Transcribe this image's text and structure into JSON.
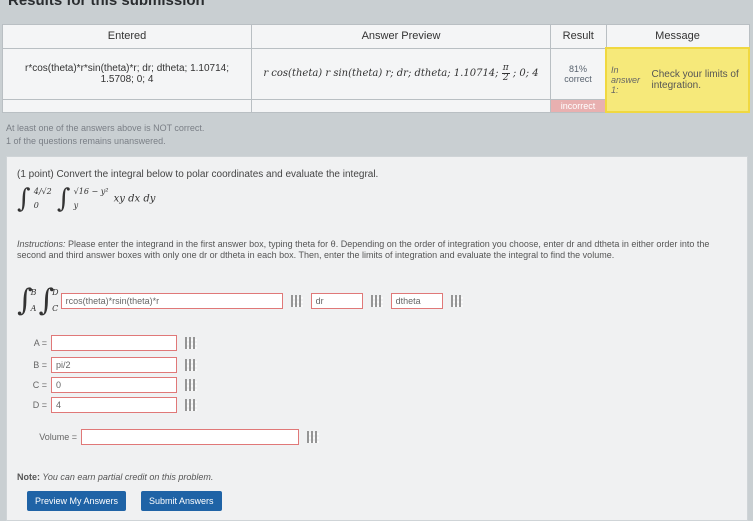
{
  "heading": "Results for this submission",
  "table": {
    "headers": [
      "Entered",
      "Answer Preview",
      "Result",
      "Message"
    ],
    "entered": "r*cos(theta)*r*sin(theta)*r; dr; dtheta; 1.10714; 1.5708; 0; 4",
    "preview_left": "r cos(theta) r sin(theta) r; dr; dtheta; 1.10714;",
    "preview_frac_num": "π",
    "preview_frac_den": "2",
    "preview_right": "; 0; 4",
    "result": "81% correct",
    "message_prefix": "In answer 1:",
    "message_text": "Check your limits of integration.",
    "incorrect": "incorrect"
  },
  "warnings": {
    "line1": "At least one of the answers above is NOT correct.",
    "line2": "1 of the questions remains unanswered."
  },
  "problem": {
    "intro": "(1 point) Convert the integral below to polar coordinates and evaluate the integral.",
    "outer_upper": "4/√2",
    "outer_lower": "0",
    "inner_upper": "√16 − y²",
    "inner_lower": "y",
    "integrand": "xy dx dy",
    "instructions_lead": "Instructions:",
    "instructions": " Please enter the integrand in the first answer box, typing theta for θ. Depending on the order of integration you choose, enter dr and dtheta in either order into the second and third answer boxes with only one dr or dtheta in each box. Then, enter the limits of integration and evaluate the integral to find the volume.",
    "lim_B": "B",
    "lim_A": "A",
    "lim_D": "D",
    "lim_C": "C",
    "integrand_value": "rcos(theta)*rsin(theta)*r",
    "d1_value": "dr",
    "d2_value": "dtheta",
    "A_label": "A =",
    "A_value": "",
    "B_label": "B =",
    "B_value": "pi/2",
    "C_label": "C =",
    "C_value": "0",
    "D_label": "D =",
    "D_value": "4",
    "volume_label": "Volume =",
    "volume_value": "",
    "note_bold": "Note:",
    "note": " You can earn partial credit on this problem.",
    "preview_button": "Preview My Answers",
    "submit_button": "Submit Answers"
  },
  "colors": {
    "accent": "#1f63a6",
    "message_bg": "#f6e97a",
    "incorrect_bg": "#e8b0b0",
    "field_border": "#e07878"
  }
}
